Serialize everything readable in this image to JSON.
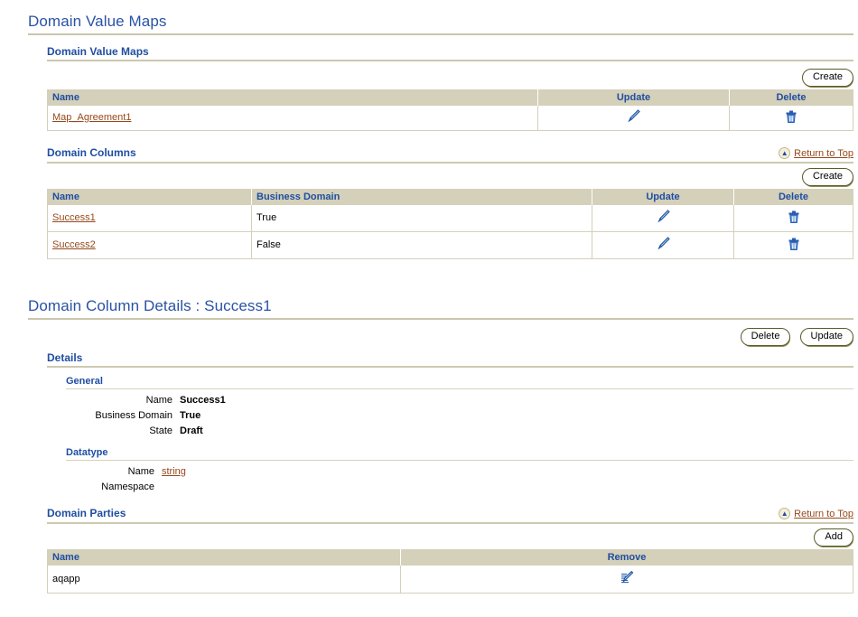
{
  "page": {
    "title": "Domain Value Maps"
  },
  "dvm_section": {
    "heading": "Domain Value Maps",
    "create_label": "Create",
    "columns": [
      "Name",
      "Update",
      "Delete"
    ],
    "rows": [
      {
        "name": "Map_Agreement1",
        "update_icon": "pencil-icon",
        "delete_icon": "trash-icon"
      }
    ]
  },
  "domain_columns_section": {
    "heading": "Domain Columns",
    "return_to_top": "Return to Top",
    "create_label": "Create",
    "columns": [
      "Name",
      "Business Domain",
      "Update",
      "Delete"
    ],
    "rows": [
      {
        "name": "Success1",
        "business_domain": "True",
        "update_icon": "pencil-icon",
        "delete_icon": "trash-icon"
      },
      {
        "name": "Success2",
        "business_domain": "False",
        "update_icon": "pencil-icon",
        "delete_icon": "trash-icon"
      }
    ]
  },
  "details_page": {
    "title": "Domain Column Details : Success1",
    "delete_label": "Delete",
    "update_label": "Update",
    "details_heading": "Details",
    "general": {
      "heading": "General",
      "fields": [
        {
          "label": "Name",
          "value": "Success1"
        },
        {
          "label": "Business Domain",
          "value": "True"
        },
        {
          "label": "State",
          "value": "Draft"
        }
      ]
    },
    "datatype": {
      "heading": "Datatype",
      "name_label": "Name",
      "name_value": "string",
      "namespace_label": "Namespace",
      "namespace_value": ""
    }
  },
  "domain_parties_section": {
    "heading": "Domain Parties",
    "return_to_top": "Return to Top",
    "add_label": "Add",
    "columns": [
      "Name",
      "Remove"
    ],
    "rows": [
      {
        "name": "aqapp",
        "remove_icon": "remove-pencil-icon"
      }
    ]
  },
  "colors": {
    "heading_blue": "#1f4ea1",
    "link_brown": "#96491b",
    "table_header_bg": "#d4d0ba",
    "rule": "#cdc9b0"
  }
}
